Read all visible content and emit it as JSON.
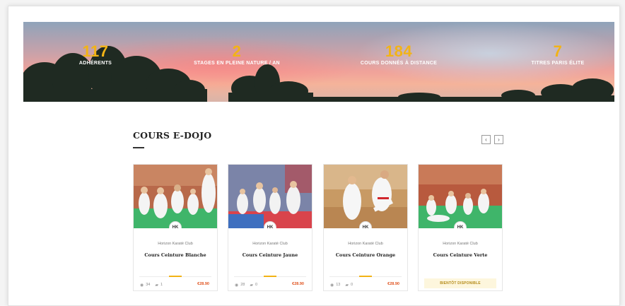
{
  "stats": [
    {
      "number": "117",
      "label": "ADHÉRENTS"
    },
    {
      "number": "2",
      "label": "STAGES EN PLEINE NATURE / AN"
    },
    {
      "number": "184",
      "label": "COURS DONNÉS À DISTANCE"
    },
    {
      "number": "7",
      "label": "TITRES PARIS ÉLITE"
    }
  ],
  "section": {
    "title": "COURS E-DOJO",
    "prev_label": "‹",
    "next_label": "›"
  },
  "colors": {
    "accent": "#f2b316",
    "price": "#e0531f"
  },
  "courses": [
    {
      "club_logo": "HK",
      "author": "Horizon Karaté Club",
      "title": "Cours Ceinture Blanche",
      "views": "34",
      "comments": "1",
      "price": "€28.90"
    },
    {
      "club_logo": "HK",
      "author": "Horizon Karaté Club",
      "title": "Cours Ceinture Jaune",
      "views": "28",
      "comments": "0",
      "price": "€28.90"
    },
    {
      "club_logo": "HK",
      "author": "Horizon Karaté Club",
      "title": "Cours Ceinture Orange",
      "views": "13",
      "comments": "0",
      "price": "€28.90"
    },
    {
      "club_logo": "HK",
      "author": "Horizon Karaté Club",
      "title": "Cours Ceinture Verte",
      "status": "BIENTÔT DISPONIBLE"
    }
  ],
  "icons": {
    "views": "eye-icon",
    "comments": "comment-icon"
  }
}
